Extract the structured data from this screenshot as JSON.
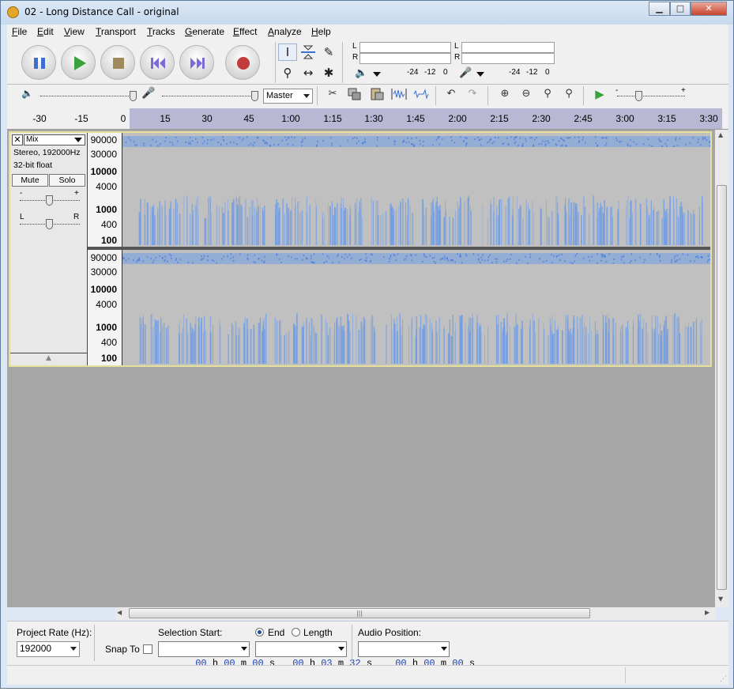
{
  "window": {
    "title": "02 - Long Distance Call - original",
    "min_label": "▁",
    "max_label": "□",
    "close_label": "✕"
  },
  "menu": [
    {
      "u": "F",
      "rest": "ile"
    },
    {
      "u": "E",
      "rest": "dit"
    },
    {
      "u": "V",
      "rest": "iew"
    },
    {
      "u": "T",
      "rest": "ransport"
    },
    {
      "u": "T",
      "rest": "racks"
    },
    {
      "u": "G",
      "rest": "enerate"
    },
    {
      "u": "E",
      "rest": "ffect"
    },
    {
      "u": "A",
      "rest": "nalyze"
    },
    {
      "u": "H",
      "rest": "elp"
    }
  ],
  "transport": {
    "pause": "pause-icon",
    "play": "play-icon",
    "stop": "stop-icon",
    "skip_start": "skip-to-start-icon",
    "skip_end": "skip-to-end-icon",
    "record": "record-icon",
    "colors": {
      "pause": "#3b6fd4",
      "play": "#3aa23a",
      "stop": "#a08a5c",
      "skip": "#7a6cd6",
      "record": "#c33c3c"
    }
  },
  "tools": {
    "select": "I",
    "envelope": "envelope-icon",
    "draw": "✎",
    "zoom": "⚲",
    "timeshift": "↔",
    "multi": "✱"
  },
  "meters": {
    "playback": {
      "L": "L",
      "R": "R",
      "ticks": [
        "-24",
        "-12",
        "0"
      ]
    },
    "record": {
      "L": "L",
      "R": "R",
      "ticks": [
        "-24",
        "-12",
        "0"
      ]
    }
  },
  "mixer": {
    "speaker_icon": "🔈",
    "mic_icon": "🎤",
    "input_source": "Master"
  },
  "ruler": {
    "labels": [
      "-30",
      "-15",
      "0",
      "15",
      "30",
      "45",
      "1:00",
      "1:15",
      "1:30",
      "1:45",
      "2:00",
      "2:15",
      "2:30",
      "2:45",
      "3:00",
      "3:15",
      "3:30"
    ],
    "selection_color": "#b8b8d4"
  },
  "track": {
    "name": "Mix",
    "info1": "Stereo, 192000Hz",
    "info2": "32-bit float",
    "mute": "Mute",
    "solo": "Solo",
    "gain_minus": "-",
    "gain_plus": "+",
    "pan_left": "L",
    "pan_right": "R",
    "collapse_icon": "▲",
    "vruler_labels": [
      "90000",
      "30000",
      "10000",
      "4000",
      "1000",
      "400",
      "100"
    ],
    "spectrogram_color": "#6f9ce6"
  },
  "selection_toolbar": {
    "project_rate_label": "Project Rate (Hz):",
    "project_rate": "192000",
    "snap_to_label": "Snap To",
    "selection_start_label": "Selection Start:",
    "end_label": "End",
    "length_label": "Length",
    "audio_position_label": "Audio Position:",
    "start": [
      "00",
      "h",
      "00",
      "m",
      "00",
      "s"
    ],
    "end": [
      "00",
      "h",
      "03",
      "m",
      "32",
      "s"
    ],
    "position": [
      "00",
      "h",
      "00",
      "m",
      "00",
      "s"
    ]
  }
}
